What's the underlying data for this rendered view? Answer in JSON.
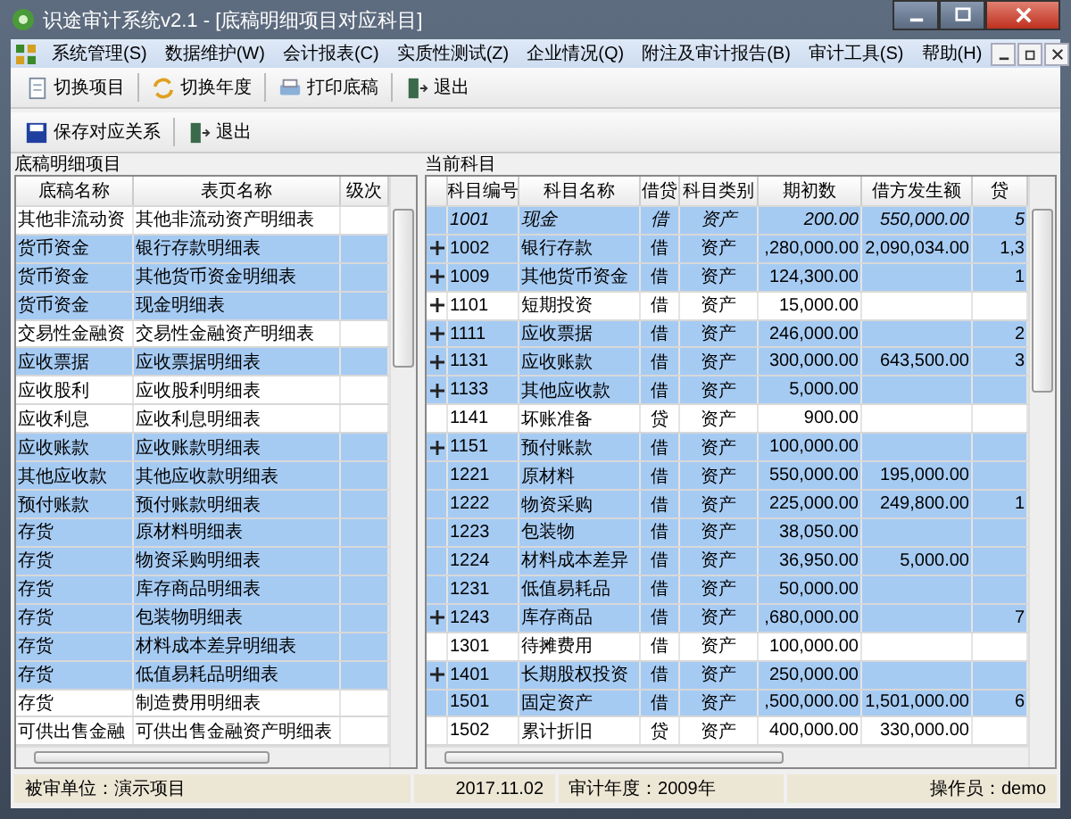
{
  "window": {
    "title": "识途审计系统v2.1 - [底稿明细项目对应科目]"
  },
  "menu": [
    "系统管理(S)",
    "数据维护(W)",
    "会计报表(C)",
    "实质性测试(Z)",
    "企业情况(Q)",
    "附注及审计报告(B)",
    "审计工具(S)",
    "帮助(H)"
  ],
  "toolbar": [
    {
      "label": "切换项目",
      "kind": "document"
    },
    {
      "label": "切换年度",
      "kind": "switch"
    },
    {
      "label": "打印底稿",
      "kind": "print"
    },
    {
      "label": "退出",
      "kind": "exit"
    }
  ],
  "subtoolbar": [
    {
      "label": "保存对应关系",
      "kind": "save"
    },
    {
      "label": "退出",
      "kind": "exit"
    }
  ],
  "left": {
    "title": "底稿明细项目",
    "columns": [
      "底稿名称",
      "表页名称",
      "级次"
    ],
    "rows": [
      {
        "name": "其他非流动资",
        "page": "其他非流动资产明细表",
        "selected": false
      },
      {
        "name": "货币资金",
        "page": "银行存款明细表",
        "selected": true
      },
      {
        "name": "货币资金",
        "page": "其他货币资金明细表",
        "selected": true
      },
      {
        "name": "货币资金",
        "page": "现金明细表",
        "selected": true
      },
      {
        "name": "交易性金融资",
        "page": "交易性金融资产明细表",
        "selected": false
      },
      {
        "name": "应收票据",
        "page": "应收票据明细表",
        "selected": true
      },
      {
        "name": "应收股利",
        "page": "应收股利明细表",
        "selected": false
      },
      {
        "name": "应收利息",
        "page": "应收利息明细表",
        "selected": false
      },
      {
        "name": "应收账款",
        "page": "应收账款明细表",
        "selected": true
      },
      {
        "name": "其他应收款",
        "page": "其他应收款明细表",
        "selected": true
      },
      {
        "name": "预付账款",
        "page": "预付账款明细表",
        "selected": true
      },
      {
        "name": "存货",
        "page": "原材料明细表",
        "selected": true
      },
      {
        "name": "存货",
        "page": "物资采购明细表",
        "selected": true
      },
      {
        "name": "存货",
        "page": "库存商品明细表",
        "selected": true
      },
      {
        "name": "存货",
        "page": "包装物明细表",
        "selected": true
      },
      {
        "name": "存货",
        "page": "材料成本差异明细表",
        "selected": true
      },
      {
        "name": "存货",
        "page": "低值易耗品明细表",
        "selected": true
      },
      {
        "name": "存货",
        "page": "制造费用明细表",
        "selected": false
      },
      {
        "name": "可供出售金融",
        "page": "可供出售金融资产明细表",
        "selected": false
      }
    ]
  },
  "right": {
    "title": "当前科目",
    "columns": [
      "科目编号",
      "科目名称",
      "借贷",
      "科目类别",
      "期初数",
      "借方发生额",
      "贷"
    ],
    "rows": [
      {
        "code": "1001",
        "name": "现金",
        "dc": "借",
        "type": "资产",
        "opening": "200.00",
        "debit": "550,000.00",
        "credit": "5",
        "expandable": false,
        "current": true,
        "selected": true
      },
      {
        "code": "1002",
        "name": "银行存款",
        "dc": "借",
        "type": "资产",
        "opening": ",280,000.00",
        "debit": "2,090,034.00",
        "credit": "1,3",
        "expandable": true,
        "current": false,
        "selected": true
      },
      {
        "code": "1009",
        "name": "其他货币资金",
        "dc": "借",
        "type": "资产",
        "opening": "124,300.00",
        "debit": "",
        "credit": "1",
        "expandable": true,
        "current": false,
        "selected": true
      },
      {
        "code": "1101",
        "name": "短期投资",
        "dc": "借",
        "type": "资产",
        "opening": "15,000.00",
        "debit": "",
        "credit": "",
        "expandable": true,
        "current": false,
        "selected": false
      },
      {
        "code": "1111",
        "name": "应收票据",
        "dc": "借",
        "type": "资产",
        "opening": "246,000.00",
        "debit": "",
        "credit": "2",
        "expandable": true,
        "current": false,
        "selected": true
      },
      {
        "code": "1131",
        "name": "应收账款",
        "dc": "借",
        "type": "资产",
        "opening": "300,000.00",
        "debit": "643,500.00",
        "credit": "3",
        "expandable": true,
        "current": false,
        "selected": true
      },
      {
        "code": "1133",
        "name": "其他应收款",
        "dc": "借",
        "type": "资产",
        "opening": "5,000.00",
        "debit": "",
        "credit": "",
        "expandable": true,
        "current": false,
        "selected": true
      },
      {
        "code": "1141",
        "name": "坏账准备",
        "dc": "贷",
        "type": "资产",
        "opening": "900.00",
        "debit": "",
        "credit": "",
        "expandable": false,
        "current": false,
        "selected": false
      },
      {
        "code": "1151",
        "name": "预付账款",
        "dc": "借",
        "type": "资产",
        "opening": "100,000.00",
        "debit": "",
        "credit": "",
        "expandable": true,
        "current": false,
        "selected": true
      },
      {
        "code": "1221",
        "name": "原材料",
        "dc": "借",
        "type": "资产",
        "opening": "550,000.00",
        "debit": "195,000.00",
        "credit": "",
        "expandable": false,
        "current": false,
        "selected": true
      },
      {
        "code": "1222",
        "name": "物资采购",
        "dc": "借",
        "type": "资产",
        "opening": "225,000.00",
        "debit": "249,800.00",
        "credit": "1",
        "expandable": false,
        "current": false,
        "selected": true
      },
      {
        "code": "1223",
        "name": "包装物",
        "dc": "借",
        "type": "资产",
        "opening": "38,050.00",
        "debit": "",
        "credit": "",
        "expandable": false,
        "current": false,
        "selected": true
      },
      {
        "code": "1224",
        "name": "材料成本差异",
        "dc": "借",
        "type": "资产",
        "opening": "36,950.00",
        "debit": "5,000.00",
        "credit": "",
        "expandable": false,
        "current": false,
        "selected": true
      },
      {
        "code": "1231",
        "name": "低值易耗品",
        "dc": "借",
        "type": "资产",
        "opening": "50,000.00",
        "debit": "",
        "credit": "",
        "expandable": false,
        "current": false,
        "selected": true
      },
      {
        "code": "1243",
        "name": "库存商品",
        "dc": "借",
        "type": "资产",
        "opening": ",680,000.00",
        "debit": "",
        "credit": "7",
        "expandable": true,
        "current": false,
        "selected": true
      },
      {
        "code": "1301",
        "name": "待摊费用",
        "dc": "借",
        "type": "资产",
        "opening": "100,000.00",
        "debit": "",
        "credit": "",
        "expandable": false,
        "current": false,
        "selected": false
      },
      {
        "code": "1401",
        "name": "长期股权投资",
        "dc": "借",
        "type": "资产",
        "opening": "250,000.00",
        "debit": "",
        "credit": "",
        "expandable": true,
        "current": false,
        "selected": true
      },
      {
        "code": "1501",
        "name": "固定资产",
        "dc": "借",
        "type": "资产",
        "opening": ",500,000.00",
        "debit": "1,501,000.00",
        "credit": "6",
        "expandable": false,
        "current": false,
        "selected": true
      },
      {
        "code": "1502",
        "name": "累计折旧",
        "dc": "贷",
        "type": "资产",
        "opening": "400,000.00",
        "debit": "330,000.00",
        "credit": "",
        "expandable": false,
        "current": false,
        "selected": false
      }
    ]
  },
  "status_bar": {
    "unit": "被审单位：演示项目",
    "date": "2017.11.02",
    "year": "审计年度：2009年",
    "operator": "操作员：demo"
  }
}
